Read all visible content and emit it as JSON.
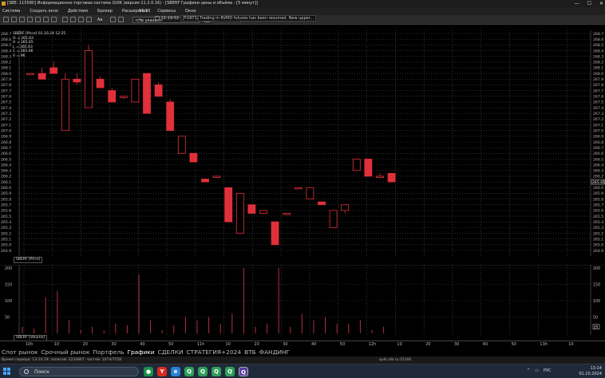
{
  "window": {
    "title": "[SBE: 115580] Информационно-торговая система QUIK (версия 11.2.0.16) - [SBERF Графики цены и объёма - [5 минут]]",
    "buttons": [
      "—",
      "☐",
      "✕"
    ]
  },
  "menu": [
    "Система",
    "Создать окно",
    "Действия",
    "Брокер",
    "Расширения",
    "Сервисы",
    "Окна"
  ],
  "toolbar": {
    "interval": "15:15",
    "time": "12:19:52",
    "message": "[FORTS] Trading in RVMD futures has been resumed. New upper...",
    "dropdown": "<Не указан>",
    "font_sample": "Aa"
  },
  "legend": {
    "title": "SBERF [Price] 01.10.24 12:25",
    "lines": [
      "O = 265.63",
      "H = 265.65",
      "L = 265.63",
      "C = 265.66",
      "V = 96"
    ]
  },
  "price_panel_label": "SBERF [Price]",
  "volume_panel_label": "SBERF [Volume]",
  "price_ticks": [
    "268.7",
    "268.6",
    "268.5",
    "268.4",
    "268.3",
    "268.2",
    "268.1",
    "268.0",
    "267.9",
    "267.8",
    "267.7",
    "267.6",
    "267.5",
    "267.4",
    "267.3",
    "267.2",
    "267.1",
    "267.0",
    "266.9",
    "266.8",
    "266.7",
    "266.6",
    "266.5",
    "266.4",
    "266.3",
    "266.2",
    "266.1",
    "266.0",
    "265.9",
    "265.8",
    "265.7",
    "265.6",
    "265.5",
    "265.4",
    "265.3",
    "265.2",
    "265.1",
    "265.0",
    "264.9"
  ],
  "last_price_label": "265.65",
  "volume_ticks": [
    "200",
    "150",
    "100",
    "50"
  ],
  "volume_last_label": "25",
  "time_axis": [
    "10h",
    "10",
    "20",
    "30",
    "40",
    "50",
    "11h",
    "10",
    "20",
    "30",
    "40",
    "50",
    "12h",
    "10",
    "20",
    "30",
    "40",
    "50",
    "13h",
    "10"
  ],
  "tabs": [
    "Спот рынок",
    "Срочный рынок",
    "Портфель",
    "Графики",
    "СДЕЛКИ",
    "СТРАТЕГИЯ+2024",
    "ВТБ",
    "ФАНДИНГ"
  ],
  "statusbar": {
    "left": "Время сервера: 13:14:19; записей: 2234867; частей: 1074/7558",
    "center": "quik.vtb.ru:15100"
  },
  "taskbar": {
    "search": "Поиск",
    "time": "13:14",
    "date": "01.10.2024",
    "lang": "РУС"
  },
  "chart_data": {
    "type": "candlestick",
    "interval": "5 минут",
    "ylim": [
      264.9,
      268.7
    ],
    "up_color": "#000000",
    "down_color": "#e0303a",
    "series": [
      {
        "name": "SBERF [Price]",
        "candles": [
          {
            "o": 268.0,
            "h": 268.0,
            "l": 268.0,
            "c": 268.0
          },
          {
            "o": 268.0,
            "h": 268.1,
            "l": 267.9,
            "c": 267.9
          },
          {
            "o": 268.1,
            "h": 268.2,
            "l": 268.0,
            "c": 268.0
          },
          {
            "o": 267.0,
            "h": 268.0,
            "l": 267.0,
            "c": 267.9
          },
          {
            "o": 267.9,
            "h": 268.0,
            "l": 267.8,
            "c": 267.85
          },
          {
            "o": 267.4,
            "h": 268.5,
            "l": 267.4,
            "c": 268.4
          },
          {
            "o": 267.9,
            "h": 267.95,
            "l": 267.75,
            "c": 267.75
          },
          {
            "o": 267.7,
            "h": 267.75,
            "l": 267.5,
            "c": 267.5
          },
          {
            "o": 267.6,
            "h": 267.6,
            "l": 267.55,
            "c": 267.6
          },
          {
            "o": 267.5,
            "h": 267.9,
            "l": 267.5,
            "c": 267.9
          },
          {
            "o": 268.0,
            "h": 268.0,
            "l": 267.3,
            "c": 267.3
          },
          {
            "o": 267.8,
            "h": 267.85,
            "l": 267.6,
            "c": 267.6
          },
          {
            "o": 267.5,
            "h": 267.55,
            "l": 267.0,
            "c": 267.0
          },
          {
            "o": 266.6,
            "h": 266.9,
            "l": 266.6,
            "c": 266.9
          },
          {
            "o": 266.6,
            "h": 266.6,
            "l": 266.45,
            "c": 266.45
          },
          {
            "o": 266.15,
            "h": 266.15,
            "l": 266.1,
            "c": 266.1
          },
          {
            "o": 266.2,
            "h": 266.2,
            "l": 266.2,
            "c": 266.2
          },
          {
            "o": 266.0,
            "h": 266.0,
            "l": 265.4,
            "c": 265.4
          },
          {
            "o": 265.2,
            "h": 265.9,
            "l": 265.2,
            "c": 265.9
          },
          {
            "o": 265.7,
            "h": 265.7,
            "l": 265.55,
            "c": 265.55
          },
          {
            "o": 265.55,
            "h": 265.6,
            "l": 265.55,
            "c": 265.6
          },
          {
            "o": 265.4,
            "h": 265.4,
            "l": 265.0,
            "c": 265.0
          },
          {
            "o": 265.55,
            "h": 265.55,
            "l": 265.55,
            "c": 265.55
          },
          {
            "o": 266.0,
            "h": 266.0,
            "l": 266.0,
            "c": 266.0
          },
          {
            "o": 265.8,
            "h": 266.0,
            "l": 265.8,
            "c": 266.0
          },
          {
            "o": 265.75,
            "h": 265.75,
            "l": 265.7,
            "c": 265.7
          },
          {
            "o": 265.3,
            "h": 265.6,
            "l": 265.3,
            "c": 265.6
          },
          {
            "o": 265.6,
            "h": 265.7,
            "l": 265.55,
            "c": 265.7
          },
          {
            "o": 266.3,
            "h": 266.5,
            "l": 266.3,
            "c": 266.5
          },
          {
            "o": 266.5,
            "h": 266.5,
            "l": 266.2,
            "c": 266.2
          },
          {
            "o": 266.2,
            "h": 266.25,
            "l": 266.2,
            "c": 266.2
          },
          {
            "o": 266.25,
            "h": 266.25,
            "l": 266.1,
            "c": 266.1
          }
        ]
      },
      {
        "name": "SBERF [Volume]",
        "values": [
          20,
          15,
          110,
          130,
          40,
          10,
          20,
          10,
          30,
          25,
          180,
          40,
          10,
          25,
          50,
          40,
          50,
          30,
          60,
          200,
          20,
          30,
          200,
          20,
          60,
          40,
          50,
          30,
          30,
          40,
          10,
          20
        ]
      }
    ],
    "volume_ylim": [
      0,
      200
    ]
  }
}
